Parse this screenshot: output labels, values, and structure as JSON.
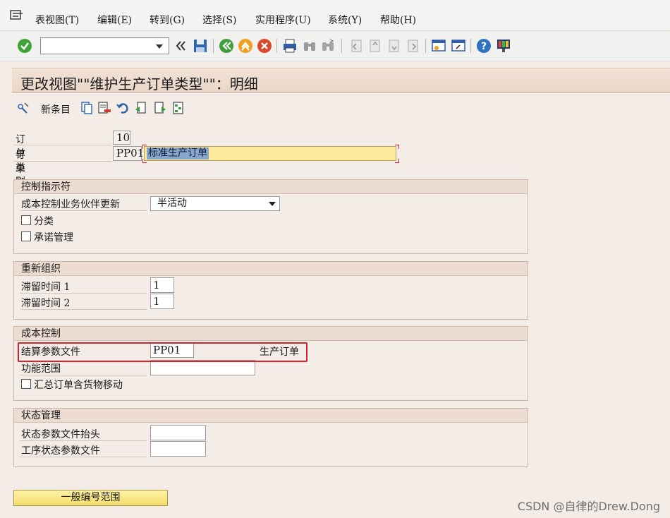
{
  "menubar": {
    "items": [
      "表视图(T)",
      "编辑(E)",
      "转到(G)",
      "选择(S)",
      "实用程序(U)",
      "系统(Y)",
      "帮助(H)"
    ]
  },
  "toolbar": {
    "command_field_value": "",
    "icons": [
      "check-icon",
      "back-double-arrow-icon",
      "save-icon",
      "back-icon",
      "exit-icon",
      "cancel-icon",
      "print-icon",
      "find-icon",
      "find-next-icon",
      "first-page-icon",
      "prev-page-icon",
      "next-page-icon",
      "last-page-icon",
      "new-session-icon",
      "shortcut-icon",
      "help-icon",
      "customize-layout-icon"
    ]
  },
  "title": "更改视图\"\"维护生产订单类型\"\"：明细",
  "app_toolbar": {
    "new_entries_label": "新条目"
  },
  "header": {
    "order_category_label": "订单类别",
    "order_category_value": "10",
    "order_type_label": "订单类型",
    "order_type_value": "PP01",
    "order_type_desc": "标准生产订单"
  },
  "control_indicators": {
    "title": "控制指示符",
    "co_partner_update_label": "成本控制业务伙伴更新",
    "co_partner_update_value": "半活动",
    "classification_label": "分类",
    "commitments_label": "承诺管理"
  },
  "reorganization": {
    "title": "重新组织",
    "residence_time_1_label": "滞留时间 1",
    "residence_time_1_value": "1",
    "residence_time_2_label": "滞留时间 2",
    "residence_time_2_value": "1"
  },
  "cost_control": {
    "title": "成本控制",
    "settlement_profile_label": "结算参数文件",
    "settlement_profile_value": "PP01",
    "settlement_profile_desc": "生产订单",
    "functional_area_label": "功能范围",
    "functional_area_value": "",
    "collective_order_label": "汇总订单含货物移动"
  },
  "status_management": {
    "title": "状态管理",
    "status_profile_header_label": "状态参数文件抬头",
    "status_profile_header_value": "",
    "operation_status_profile_label": "工序状态参数文件",
    "operation_status_profile_value": ""
  },
  "general_number_range_button": "一般编号范围",
  "watermark": "CSDN @自律的Drew.Dong",
  "colors": {
    "highlight_border": "#d4232a",
    "title_bar_bg": "#ecdcd1",
    "required_field_bg": "#fde99b",
    "selection_bg": "#88a6cc"
  }
}
